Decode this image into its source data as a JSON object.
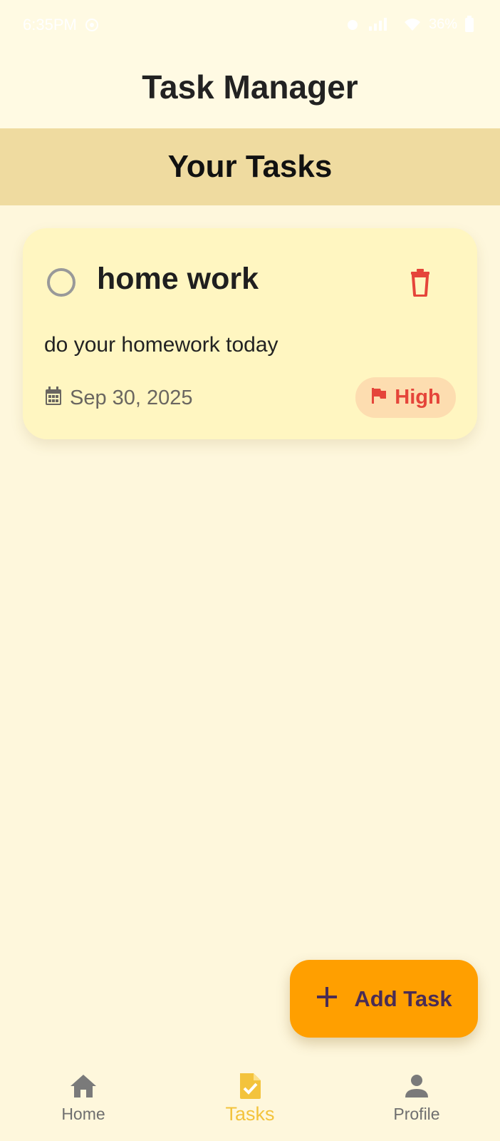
{
  "status_bar": {
    "time": "6:35PM",
    "battery": "36%"
  },
  "app_bar": {
    "title": "Task Manager"
  },
  "section": {
    "title": "Your Tasks"
  },
  "tasks": [
    {
      "title": "home work",
      "description": "do your homework today",
      "date": "Sep 30, 2025",
      "priority": "High",
      "completed": false,
      "icons": {
        "check": "radio-unchecked-icon",
        "delete": "trash-icon",
        "date": "calendar-icon",
        "priority": "flag-icon"
      }
    }
  ],
  "fab": {
    "label": "Add Task",
    "icon": "plus-icon"
  },
  "bottom_nav": {
    "items": [
      {
        "label": "Home",
        "icon": "home-icon",
        "active": false
      },
      {
        "label": "Tasks",
        "icon": "task-document-icon",
        "active": true
      },
      {
        "label": "Profile",
        "icon": "person-icon",
        "active": false
      }
    ]
  },
  "colors": {
    "background": "#FEF7DC",
    "app_bar": "#FFFAE3",
    "section_header": "#EFDBA0",
    "card": "#FFF6C1",
    "accent": "#FF9F00",
    "priority_high": "#E5453A",
    "priority_badge_bg": "#FDDDB0",
    "active_nav": "#F3C33C",
    "inactive_nav": "#6F6F6F"
  }
}
